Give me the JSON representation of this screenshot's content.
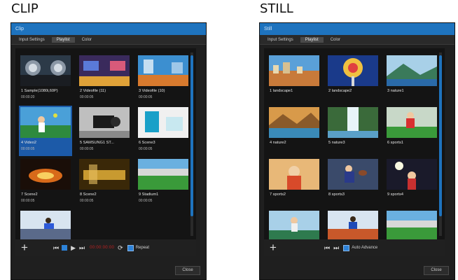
{
  "captions": {
    "clip": "CLIP",
    "still": "STILL"
  },
  "clip": {
    "title": "Clip",
    "tabs": [
      {
        "label": "Input Settings",
        "active": false
      },
      {
        "label": "Playlist",
        "active": true
      },
      {
        "label": "Color",
        "active": false
      }
    ],
    "items": [
      {
        "name": "1 Sample(1080i,60P)",
        "time": "00:00:20",
        "selected": false,
        "thumb": "cockpit"
      },
      {
        "name": "2 Videofile (11)",
        "time": "00:00:05",
        "selected": false,
        "thumb": "studio"
      },
      {
        "name": "3 Videofile (10)",
        "time": "00:00:05",
        "selected": false,
        "thumb": "stage"
      },
      {
        "name": "4 Video2",
        "time": "00:00:05",
        "selected": true,
        "thumb": "tennis"
      },
      {
        "name": "5 SAMSUNG1 ST...",
        "time": "00:00:05",
        "selected": false,
        "thumb": "camera"
      },
      {
        "name": "6 Scene3",
        "time": "00:00:05",
        "selected": false,
        "thumb": "bluebox"
      },
      {
        "name": "7 Scene2",
        "time": "00:00:05",
        "selected": false,
        "thumb": "fire"
      },
      {
        "name": "8 Scene2",
        "time": "00:00:05",
        "selected": false,
        "thumb": "gold"
      },
      {
        "name": "9 Stadium1",
        "time": "00:00:05",
        "selected": false,
        "thumb": "stadium"
      },
      {
        "name": "",
        "time": "",
        "selected": false,
        "thumb": "runner"
      }
    ],
    "controls": {
      "rec_label": "00:00:00:00",
      "repeat_label": "Repeat",
      "close_label": "Close"
    }
  },
  "still": {
    "title": "Still",
    "tabs": [
      {
        "label": "Input Settings",
        "active": false
      },
      {
        "label": "Playlist",
        "active": true
      },
      {
        "label": "Color",
        "active": false
      }
    ],
    "items": [
      {
        "name": "1 landscape1",
        "selected": false,
        "thumb": "city"
      },
      {
        "name": "2 landscape2",
        "selected": false,
        "thumb": "carousel"
      },
      {
        "name": "3 nature1",
        "selected": false,
        "thumb": "mountain"
      },
      {
        "name": "4 nature2",
        "selected": false,
        "thumb": "lake"
      },
      {
        "name": "5 nature3",
        "selected": false,
        "thumb": "waterfall"
      },
      {
        "name": "6 sports1",
        "selected": false,
        "thumb": "soccer"
      },
      {
        "name": "7 sports2",
        "selected": false,
        "thumb": "racket"
      },
      {
        "name": "8 sports3",
        "selected": false,
        "thumb": "football"
      },
      {
        "name": "9 sports4",
        "selected": false,
        "thumb": "spotlight"
      },
      {
        "name": "",
        "selected": false,
        "thumb": "tennis2"
      },
      {
        "name": "",
        "selected": false,
        "thumb": "track"
      },
      {
        "name": "",
        "selected": false,
        "thumb": "stadium2"
      }
    ],
    "controls": {
      "auto_advance_label": "Auto Advance",
      "close_label": "Close"
    }
  },
  "colors": {
    "accent": "#1e73be",
    "panel": "#141414",
    "window": "#1f1f1f",
    "selected": "#1c5aa8"
  }
}
